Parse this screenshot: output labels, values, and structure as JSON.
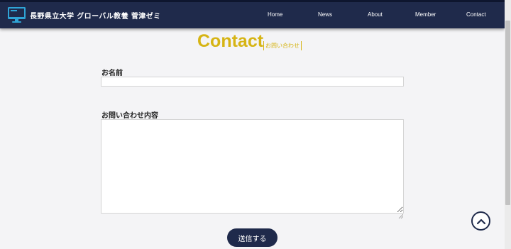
{
  "header": {
    "site_title": "長野県立大学 グローバル教養 菅津ゼミ",
    "nav": [
      "Home",
      "News",
      "About",
      "Member",
      "Contact"
    ]
  },
  "page": {
    "title": "Contact",
    "subtitle": "お問い合わせ"
  },
  "form": {
    "name_label": "お名前",
    "name_value": "",
    "message_label": "お問い合わせ内容",
    "message_value": "",
    "submit_label": "送信する"
  },
  "colors": {
    "navy": "#1f2a4b",
    "accent_gold": "#d6b414",
    "background": "#f4f4f6"
  },
  "icons": {
    "logo": "computer-monitor-icon",
    "back_to_top": "chevron-up-icon"
  }
}
